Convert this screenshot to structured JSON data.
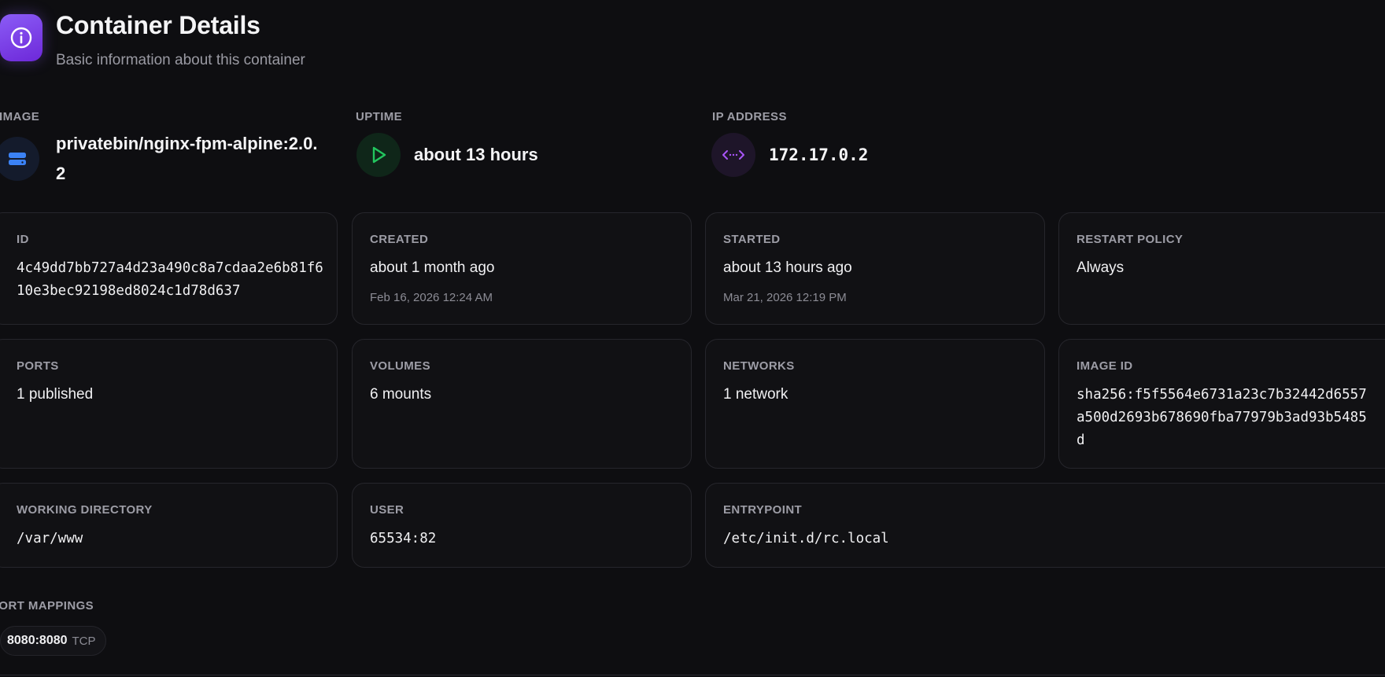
{
  "header": {
    "title": "Container Details",
    "subtitle": "Basic information about this container",
    "icon": "info-icon"
  },
  "stats": {
    "image": {
      "label": "IMAGE",
      "value": "privatebin/nginx-fpm-alpine:2.0.2",
      "icon": "server-icon",
      "color": "#3b82f6"
    },
    "uptime": {
      "label": "UPTIME",
      "value": "about 13 hours",
      "icon": "play-icon",
      "color": "#22c55e"
    },
    "ip": {
      "label": "IP ADDRESS",
      "value": "172.17.0.2",
      "icon": "network-arrows-icon",
      "color": "#a855f7"
    }
  },
  "cards": {
    "id": {
      "label": "ID",
      "value": "4c49dd7bb727a4d23a490c8a7cdaa2e6b81f610e3bec92198ed8024c1d78d637"
    },
    "created": {
      "label": "CREATED",
      "value": "about 1 month ago",
      "sub": "Feb 16, 2026 12:24 AM"
    },
    "started": {
      "label": "STARTED",
      "value": "about 13 hours ago",
      "sub": "Mar 21, 2026 12:19 PM"
    },
    "restart": {
      "label": "RESTART POLICY",
      "value": "Always"
    },
    "ports": {
      "label": "PORTS",
      "value": "1 published"
    },
    "volumes": {
      "label": "VOLUMES",
      "value": "6 mounts"
    },
    "networks": {
      "label": "NETWORKS",
      "value": "1 network"
    },
    "image_id": {
      "label": "IMAGE ID",
      "value": "sha256:f5f5564e6731a23c7b32442d6557a500d2693b678690fba77979b3ad93b5485d"
    },
    "workdir": {
      "label": "WORKING DIRECTORY",
      "value": "/var/www"
    },
    "user": {
      "label": "USER",
      "value": "65534:82"
    },
    "entrypoint": {
      "label": "ENTRYPOINT",
      "value": "/etc/init.d/rc.local"
    }
  },
  "port_mappings": {
    "label": "PORT MAPPINGS",
    "items": [
      {
        "port": "8080:8080",
        "protocol": "TCP"
      }
    ]
  },
  "colors": {
    "accent": "#8b5cf6",
    "background": "#0e0e11",
    "card_border": "#26262c"
  }
}
